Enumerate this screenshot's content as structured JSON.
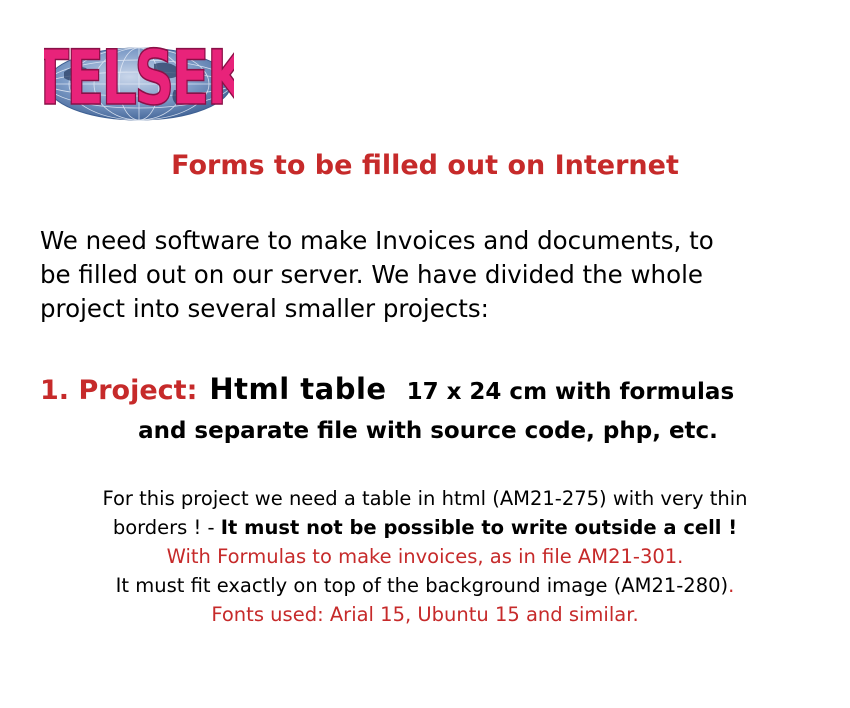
{
  "logo": {
    "text": "TELSEK",
    "colors": {
      "letters": "#e8237a",
      "globe": "#5b7fb0",
      "globe_dark": "#2f4f7f"
    }
  },
  "title": "Forms to be filled out on Internet",
  "intro": {
    "lines": [
      "We need software to make Invoices and documents, to",
      "be filled out on our server. We have divided the whole",
      "project into several smaller projects:"
    ]
  },
  "project": {
    "label": "1. Project:",
    "name": "Html  table",
    "spec": "17 x 24 cm  with formulas",
    "line2": "and separate file with source code, php, etc."
  },
  "details": {
    "line1": "For this project we need a table in html  (AM21-275) with very thin",
    "line2_plain": "borders ! - ",
    "line2_bold": "It must not be possible to write outside a cell !",
    "line3": "With Formulas to make invoices, as in file AM21-301.",
    "line4": "It must fit exactly on top of the background image  (AM21-280)",
    "line4_dot": ".",
    "line5": "Fonts used:  Arial 15, Ubuntu 15 and similar."
  },
  "colors": {
    "accent_red": "#c62a2a",
    "text": "#000000",
    "background": "#ffffff"
  }
}
